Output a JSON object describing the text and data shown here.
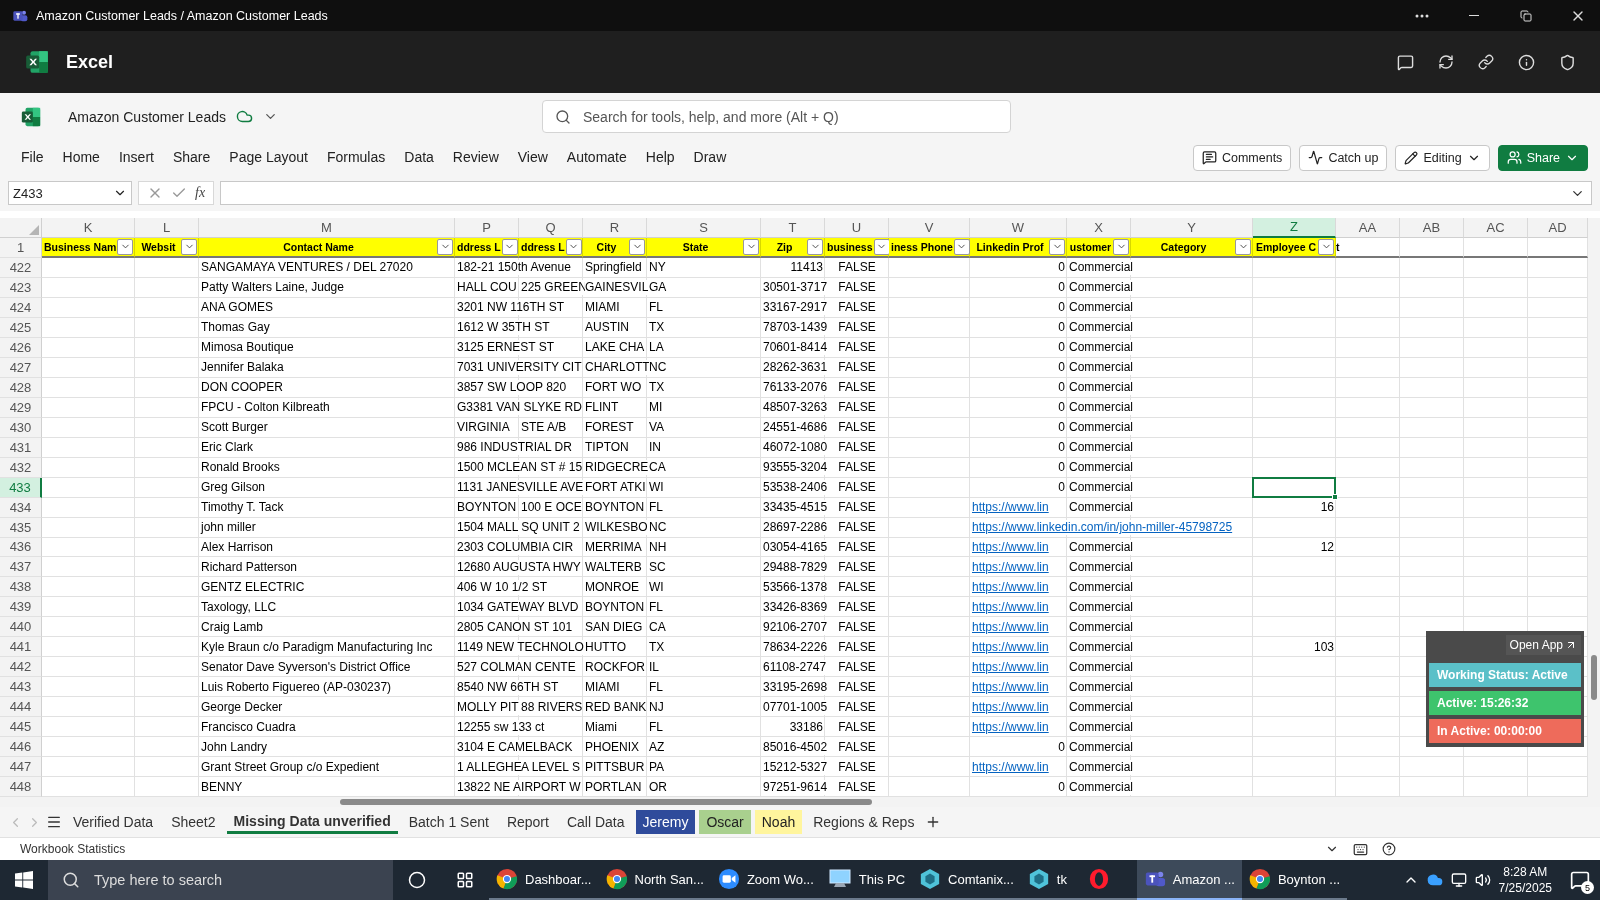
{
  "window": {
    "title": "Amazon Customer Leads / Amazon Customer Leads"
  },
  "app_bar": {
    "app_name": "Excel"
  },
  "document": {
    "name": "Amazon Customer Leads",
    "search_placeholder": "Search for tools, help, and more (Alt + Q)"
  },
  "menu": [
    {
      "label": "File",
      "selected": false
    },
    {
      "label": "Home",
      "selected": false
    },
    {
      "label": "Insert",
      "selected": false
    },
    {
      "label": "Share",
      "selected": false
    },
    {
      "label": "Page Layout",
      "selected": false
    },
    {
      "label": "Formulas",
      "selected": false
    },
    {
      "label": "Data",
      "selected": false
    },
    {
      "label": "Review",
      "selected": false
    },
    {
      "label": "View",
      "selected": false
    },
    {
      "label": "Automate",
      "selected": false
    },
    {
      "label": "Help",
      "selected": false
    },
    {
      "label": "Draw",
      "selected": false
    }
  ],
  "actions": {
    "comments": "Comments",
    "catch_up": "Catch up",
    "editing": "Editing",
    "share": "Share"
  },
  "formula_bar": {
    "name_box": "Z433",
    "function_label": "fx"
  },
  "columns": [
    {
      "letter": "K",
      "header": "Business Nam",
      "filter": true,
      "selected": false
    },
    {
      "letter": "L",
      "header": "Websit",
      "filter": true,
      "selected": false
    },
    {
      "letter": "M",
      "header": "Contact Name",
      "filter": true,
      "selected": false
    },
    {
      "letter": "P",
      "header": "ddress L",
      "filter": true,
      "selected": false
    },
    {
      "letter": "Q",
      "header": "ddress L",
      "filter": true,
      "selected": false
    },
    {
      "letter": "R",
      "header": "City",
      "filter": true,
      "selected": false
    },
    {
      "letter": "S",
      "header": "State",
      "filter": true,
      "selected": false
    },
    {
      "letter": "T",
      "header": "Zip",
      "filter": true,
      "selected": false
    },
    {
      "letter": "U",
      "header": "business",
      "filter": true,
      "selected": false
    },
    {
      "letter": "V",
      "header": "iness Phone",
      "filter": true,
      "selected": false
    },
    {
      "letter": "W",
      "header": "Linkedin Prof",
      "filter": true,
      "selected": false
    },
    {
      "letter": "X",
      "header": "ustomer",
      "filter": true,
      "selected": false
    },
    {
      "letter": "Y",
      "header": "Category",
      "filter": true,
      "selected": false
    },
    {
      "letter": "Z",
      "header": "Employee C",
      "header_overflow": "t",
      "filter": true,
      "selected": true
    },
    {
      "letter": "AA",
      "filter": false,
      "selected": false
    },
    {
      "letter": "AB",
      "filter": false,
      "selected": false
    },
    {
      "letter": "AC",
      "filter": false,
      "selected": false
    },
    {
      "letter": "AD",
      "filter": false,
      "selected": false
    }
  ],
  "header_row_number": "1",
  "rows": [
    {
      "number": "422",
      "selected": false,
      "contact_name": "SANGAMAYA VENTURES / DEL 27020",
      "address_1": "182-21 150th Avenue",
      "city": "Springfield",
      "state": "NY",
      "zip": {
        "text": "11413",
        "kind": "number"
      },
      "business": "FALSE",
      "linkedin": "0",
      "customer_type": "Commercial"
    },
    {
      "number": "423",
      "selected": false,
      "contact_name": "Patty Walters Laine, Judge",
      "address_1": "HALL COU",
      "address_2": "225 GREEN",
      "city": "GAINESVIL",
      "state": "GA",
      "zip": "30501-3717",
      "business": "FALSE",
      "linkedin": "0",
      "customer_type": "Commercial"
    },
    {
      "number": "424",
      "selected": false,
      "contact_name": "ANA GOMES",
      "address_1": "3201 NW 116TH ST",
      "city": "MIAMI",
      "state": "FL",
      "zip": "33167-2917",
      "business": "FALSE",
      "linkedin": "0",
      "customer_type": "Commercial"
    },
    {
      "number": "425",
      "selected": false,
      "contact_name": "Thomas Gay",
      "address_1": "1612 W 35TH ST",
      "city": "AUSTIN",
      "state": "TX",
      "zip": "78703-1439",
      "business": "FALSE",
      "linkedin": "0",
      "customer_type": "Commercial"
    },
    {
      "number": "426",
      "selected": false,
      "contact_name": "Mimosa Boutique",
      "address_1": "3125 ERNEST ST",
      "city": "LAKE CHA",
      "state": "LA",
      "zip": "70601-8414",
      "business": "FALSE",
      "linkedin": "0",
      "customer_type": "Commercial"
    },
    {
      "number": "427",
      "selected": false,
      "contact_name": "Jennifer Balaka",
      "address_1": "7031 UNIVERSITY CIT",
      "city": "CHARLOTT",
      "state": "NC",
      "zip": "28262-3631",
      "business": "FALSE",
      "linkedin": "0",
      "customer_type": "Commercial"
    },
    {
      "number": "428",
      "selected": false,
      "contact_name": "DON COOPER",
      "address_1": "3857 SW LOOP 820",
      "city": "FORT WO",
      "state": "TX",
      "zip": "76133-2076",
      "business": "FALSE",
      "linkedin": "0",
      "customer_type": "Commercial"
    },
    {
      "number": "429",
      "selected": false,
      "contact_name": "FPCU - Colton Kilbreath",
      "address_1": "G3381 VAN SLYKE RD",
      "city": "FLINT",
      "state": "MI",
      "zip": "48507-3263",
      "business": "FALSE",
      "linkedin": "0",
      "customer_type": "Commercial"
    },
    {
      "number": "430",
      "selected": false,
      "contact_name": "Scott Burger",
      "address_1": "VIRGINIA",
      "address_2": "STE A/B",
      "city": "FOREST",
      "state": "VA",
      "zip": "24551-4686",
      "business": "FALSE",
      "linkedin": "0",
      "customer_type": "Commercial"
    },
    {
      "number": "431",
      "selected": false,
      "contact_name": "Eric Clark",
      "address_1": "986 INDUSTRIAL DR",
      "city": "TIPTON",
      "state": "IN",
      "zip": "46072-1080",
      "business": "FALSE",
      "linkedin": "0",
      "customer_type": "Commercial"
    },
    {
      "number": "432",
      "selected": false,
      "contact_name": "Ronald Brooks",
      "address_1": "1500 MCLEAN ST # 15",
      "city": "RIDGECRE",
      "state": "CA",
      "zip": "93555-3204",
      "business": "FALSE",
      "linkedin": "0",
      "customer_type": "Commercial"
    },
    {
      "number": "433",
      "selected": true,
      "contact_name": "Greg Gilson",
      "address_1": "1131 JANESVILLE AVE",
      "city": "FORT ATKI",
      "state": "WI",
      "zip": "53538-2406",
      "business": "FALSE",
      "linkedin": "0",
      "customer_type": "Commercial"
    },
    {
      "number": "434",
      "selected": false,
      "contact_name": "Timothy T. Tack",
      "address_1": "BOYNTON",
      "address_2": "100 E OCE",
      "city": "BOYNTON",
      "state": "FL",
      "zip": "33435-4515",
      "business": "FALSE",
      "linkedin": {
        "text": "https://www.lin",
        "kind": "link"
      },
      "customer_type": "Commercial",
      "employee_count": "16"
    },
    {
      "number": "435",
      "selected": false,
      "contact_name": "john miller",
      "address_1": "1504 MALL SQ UNIT 2",
      "city": "WILKESBO",
      "state": "NC",
      "zip": "28697-2286",
      "business": "FALSE",
      "linkedin": {
        "text": "https://www.linkedin.com/in/john-miller-45798725",
        "kind": "link"
      }
    },
    {
      "number": "436",
      "selected": false,
      "contact_name": "Alex Harrison",
      "address_1": "2303 COLUMBIA CIR",
      "city": "MERRIMA",
      "state": "NH",
      "zip": "03054-4165",
      "business": "FALSE",
      "linkedin": {
        "text": "https://www.lin",
        "kind": "link"
      },
      "customer_type": "Commercial",
      "employee_count": "12"
    },
    {
      "number": "437",
      "selected": false,
      "contact_name": "Richard Patterson",
      "address_1": "12680 AUGUSTA HWY",
      "city": "WALTERB",
      "state": "SC",
      "zip": "29488-7829",
      "business": "FALSE",
      "linkedin": {
        "text": "https://www.lin",
        "kind": "link"
      },
      "customer_type": "Commercial"
    },
    {
      "number": "438",
      "selected": false,
      "contact_name": "GENTZ ELECTRIC",
      "address_1": "406 W 10 1/2 ST",
      "city": "MONROE",
      "state": "WI",
      "zip": "53566-1378",
      "business": "FALSE",
      "linkedin": {
        "text": "https://www.lin",
        "kind": "link"
      },
      "customer_type": "Commercial"
    },
    {
      "number": "439",
      "selected": false,
      "contact_name": "Taxology, LLC",
      "address_1": "1034 GATEWAY BLVD",
      "city": "BOYNTON",
      "state": "FL",
      "zip": "33426-8369",
      "business": "FALSE",
      "linkedin": {
        "text": "https://www.lin",
        "kind": "link"
      },
      "customer_type": "Commercial"
    },
    {
      "number": "440",
      "selected": false,
      "contact_name": "Craig Lamb",
      "address_1": "2805 CANON ST  101",
      "city": "SAN DIEG",
      "state": "CA",
      "zip": "92106-2707",
      "business": "FALSE",
      "linkedin": {
        "text": "https://www.lin",
        "kind": "link"
      },
      "customer_type": "Commercial"
    },
    {
      "number": "441",
      "selected": false,
      "contact_name": "Kyle Braun c/o Paradigm Manufacturing Inc",
      "address_1": "1149 NEW TECHNOLO",
      "city": "HUTTO",
      "state": "TX",
      "zip": "78634-2226",
      "business": "FALSE",
      "linkedin": {
        "text": "https://www.lin",
        "kind": "link"
      },
      "customer_type": "Commercial",
      "employee_count": "103"
    },
    {
      "number": "442",
      "selected": false,
      "contact_name": "Senator Dave Syverson's District Office",
      "address_1": "527 COLMAN CENTE",
      "city": "ROCKFOR",
      "state": "IL",
      "zip": "61108-2747",
      "business": "FALSE",
      "linkedin": {
        "text": "https://www.lin",
        "kind": "link"
      },
      "customer_type": "Commercial"
    },
    {
      "number": "443",
      "selected": false,
      "contact_name": "Luis Roberto Figuereo    (AP-030237)",
      "address_1": "8540 NW 66TH ST",
      "city": "MIAMI",
      "state": "FL",
      "zip": "33195-2698",
      "business": "FALSE",
      "linkedin": {
        "text": "https://www.lin",
        "kind": "link"
      },
      "customer_type": "Commercial"
    },
    {
      "number": "444",
      "selected": false,
      "contact_name": "George Decker",
      "address_1": "MOLLY PIT",
      "address_2": "88 RIVERS",
      "city": "RED BANK",
      "state": "NJ",
      "zip": "07701-1005",
      "business": "FALSE",
      "linkedin": {
        "text": "https://www.lin",
        "kind": "link"
      },
      "customer_type": "Commercial"
    },
    {
      "number": "445",
      "selected": false,
      "contact_name": "Francisco Cuadra",
      "address_1": "12255 sw 133 ct",
      "city": "Miami",
      "state": "FL",
      "zip": {
        "text": "33186",
        "kind": "number"
      },
      "business": "FALSE",
      "linkedin": {
        "text": "https://www.lin",
        "kind": "link"
      },
      "customer_type": "Commercial"
    },
    {
      "number": "446",
      "selected": false,
      "contact_name": "John Landry",
      "address_1": "3104 E CAMELBACK",
      "city": "PHOENIX",
      "state": "AZ",
      "zip": "85016-4502",
      "business": "FALSE",
      "linkedin": "0",
      "customer_type": "Commercial"
    },
    {
      "number": "447",
      "selected": false,
      "contact_name": "Grant Street Group c/o Expedient",
      "address_1": "1 ALLEGHE",
      "address_2": "A LEVEL S",
      "city": "PITTSBUR",
      "state": "PA",
      "zip": "15212-5327",
      "business": "FALSE",
      "linkedin": {
        "text": "https://www.lin",
        "kind": "link"
      },
      "customer_type": "Commercial"
    },
    {
      "number": "448",
      "selected": false,
      "contact_name": "BENNY",
      "address_1": "13822 NE AIRPORT W",
      "city": "PORTLAN",
      "state": "OR",
      "zip": "97251-9614",
      "business": "FALSE",
      "linkedin": "0",
      "customer_type": "Commercial"
    }
  ],
  "sheets": [
    {
      "label": "Verified Data",
      "selected": false
    },
    {
      "label": "Sheet2",
      "selected": false
    },
    {
      "label": "Missing Data unverified",
      "selected": true
    },
    {
      "label": "Batch 1 Sent",
      "selected": false
    },
    {
      "label": "Report",
      "selected": false
    },
    {
      "label": "Call Data",
      "selected": false
    },
    {
      "label": "Jeremy",
      "selected": false,
      "color": "#2f4b9b"
    },
    {
      "label": "Oscar",
      "selected": false,
      "color": "#a9d08e"
    },
    {
      "label": "Noah",
      "selected": false,
      "color": "#fff59d"
    },
    {
      "label": "Regions & Reps",
      "selected": false
    }
  ],
  "status_bar": {
    "text": "Workbook Statistics"
  },
  "tracker": {
    "open_app": "Open App",
    "working_status": "Working Status: Active",
    "active": "Active: 15:26:32",
    "inactive": "In Active: 00:00:00"
  },
  "taskbar": {
    "search_placeholder": "Type here to search",
    "apps": [
      {
        "label": "Dashboar...",
        "kind": "chrome",
        "selected": false
      },
      {
        "label": "North San...",
        "kind": "chrome",
        "selected": false
      },
      {
        "label": "Zoom Wo...",
        "kind": "zoom",
        "selected": false
      },
      {
        "label": "This PC",
        "kind": "computer",
        "selected": false
      },
      {
        "label": "Comtanix...",
        "kind": "hexagon",
        "selected": false
      },
      {
        "label": "tk",
        "kind": "hexagon",
        "selected": false
      },
      {
        "kind": "opera",
        "selected": false
      },
      {
        "label": "Amazon ...",
        "kind": "teams",
        "selected": true
      },
      {
        "label": "Boynton ...",
        "kind": "chrome",
        "selected": false
      }
    ],
    "time": "8:28 AM",
    "date": "7/25/2025",
    "notifications": "5"
  }
}
